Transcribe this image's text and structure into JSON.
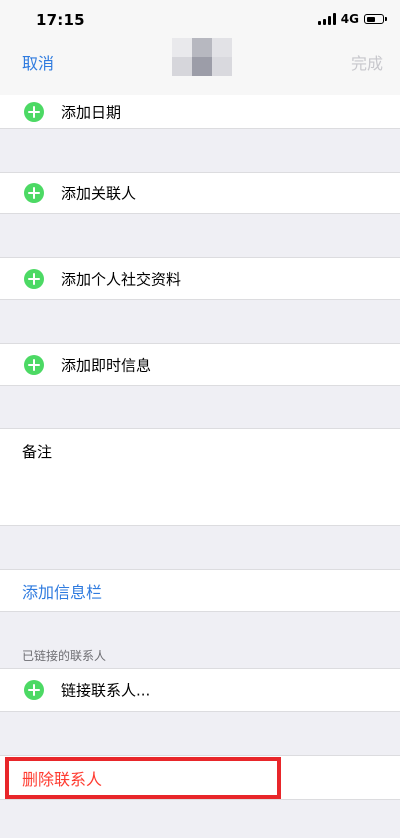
{
  "status_bar": {
    "time": "17:15",
    "network": "4G",
    "battery_level": 0.6
  },
  "nav": {
    "cancel_label": "取消",
    "done_label": "完成"
  },
  "rows": {
    "add_date": "添加日期",
    "add_related": "添加关联人",
    "add_social": "添加个人社交资料",
    "add_im": "添加即时信息",
    "notes_label": "备注",
    "add_field": "添加信息栏",
    "linked_caption": "已链接的联系人",
    "link_contacts": "链接联系人...",
    "delete_contact": "删除联系人"
  },
  "colors": {
    "accent_blue": "#2f7bdf",
    "add_green": "#4cd964",
    "delete_red": "#ff3b30",
    "highlight_red": "#e8262a",
    "done_disabled": "#c7c7cc",
    "group_background": "#efeff4"
  },
  "icons": {
    "add": "plus-circle-icon"
  }
}
